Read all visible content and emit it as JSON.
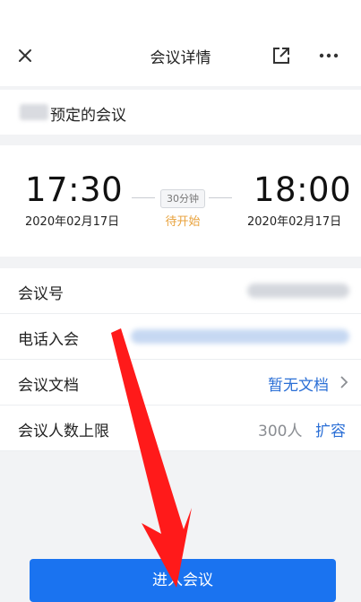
{
  "header": {
    "title": "会议详情",
    "close_icon": "close-icon",
    "share_icon": "open-external-icon",
    "more_icon": "more-dots-icon"
  },
  "organizer": {
    "text": "预定的会议"
  },
  "schedule": {
    "start_time": "17:30",
    "start_date": "2020年02月17日",
    "end_time": "18:00",
    "end_date": "2020年02月17日",
    "duration": "30分钟",
    "status": "待开始"
  },
  "info": {
    "meeting_id_label": "会议号",
    "phone_label": "电话入会",
    "docs_label": "会议文档",
    "docs_value": "暂无文档",
    "limit_label": "会议人数上限",
    "limit_value": "300人",
    "expand_label": "扩容"
  },
  "actions": {
    "join_label": "进入会议"
  },
  "colors": {
    "accent": "#1a73f0",
    "link": "#2b6fd6",
    "status": "#e8a23c",
    "annotation": "#ff1a1a"
  }
}
